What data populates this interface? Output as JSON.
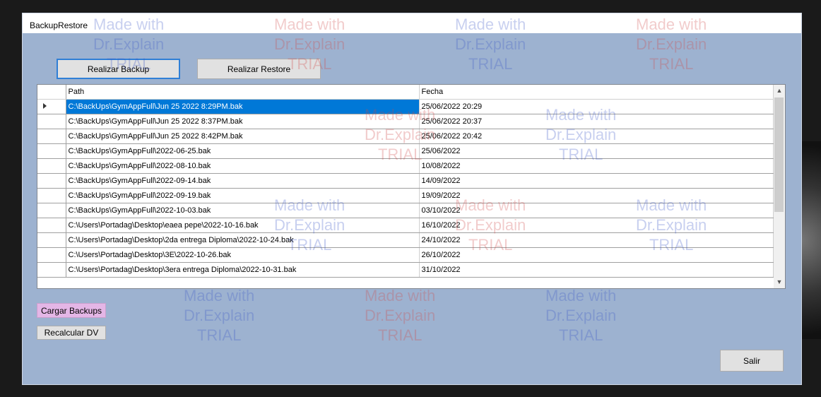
{
  "window": {
    "title": "BackupRestore"
  },
  "toolbar": {
    "backup_label": "Realizar Backup",
    "restore_label": "Realizar Restore"
  },
  "grid": {
    "columns": [
      "Path",
      "Fecha"
    ],
    "rows": [
      {
        "path": "C:\\BackUps\\GymAppFull\\Jun 25 2022  8:29PM.bak",
        "fecha": "25/06/2022 20:29"
      },
      {
        "path": "C:\\BackUps\\GymAppFull\\Jun 25 2022  8:37PM.bak",
        "fecha": "25/06/2022 20:37"
      },
      {
        "path": "C:\\BackUps\\GymAppFull\\Jun 25 2022  8:42PM.bak",
        "fecha": "25/06/2022 20:42"
      },
      {
        "path": "C:\\BackUps\\GymAppFull\\2022-06-25.bak",
        "fecha": "25/06/2022"
      },
      {
        "path": "C:\\BackUps\\GymAppFull\\2022-08-10.bak",
        "fecha": "10/08/2022"
      },
      {
        "path": "C:\\BackUps\\GymAppFull\\2022-09-14.bak",
        "fecha": "14/09/2022"
      },
      {
        "path": "C:\\BackUps\\GymAppFull\\2022-09-19.bak",
        "fecha": "19/09/2022"
      },
      {
        "path": "C:\\BackUps\\GymAppFull\\2022-10-03.bak",
        "fecha": "03/10/2022"
      },
      {
        "path": "C:\\Users\\Portadag\\Desktop\\eaea pepe\\2022-10-16.bak",
        "fecha": "16/10/2022"
      },
      {
        "path": "C:\\Users\\Portadag\\Desktop\\2da entrega Diploma\\2022-10-24.bak",
        "fecha": "24/10/2022"
      },
      {
        "path": "C:\\Users\\Portadag\\Desktop\\3E\\2022-10-26.bak",
        "fecha": "26/10/2022"
      },
      {
        "path": "C:\\Users\\Portadag\\Desktop\\3era entrega Diploma\\2022-10-31.bak",
        "fecha": "31/10/2022"
      }
    ]
  },
  "actions": {
    "load_label": "Cargar Backups",
    "recalc_label": "Recalcular DV",
    "exit_label": "Salir"
  },
  "watermark": {
    "lines": [
      "Made with",
      "Dr.Explain",
      "TRIAL"
    ]
  },
  "colors": {
    "window_bg": "#9db2d0",
    "selection": "#0078d7",
    "load_button": "#e4b6e6"
  },
  "icons": {
    "row_indicator": "arrow-right-icon",
    "scroll_up": "chevron-up-icon",
    "scroll_down": "chevron-down-icon"
  }
}
